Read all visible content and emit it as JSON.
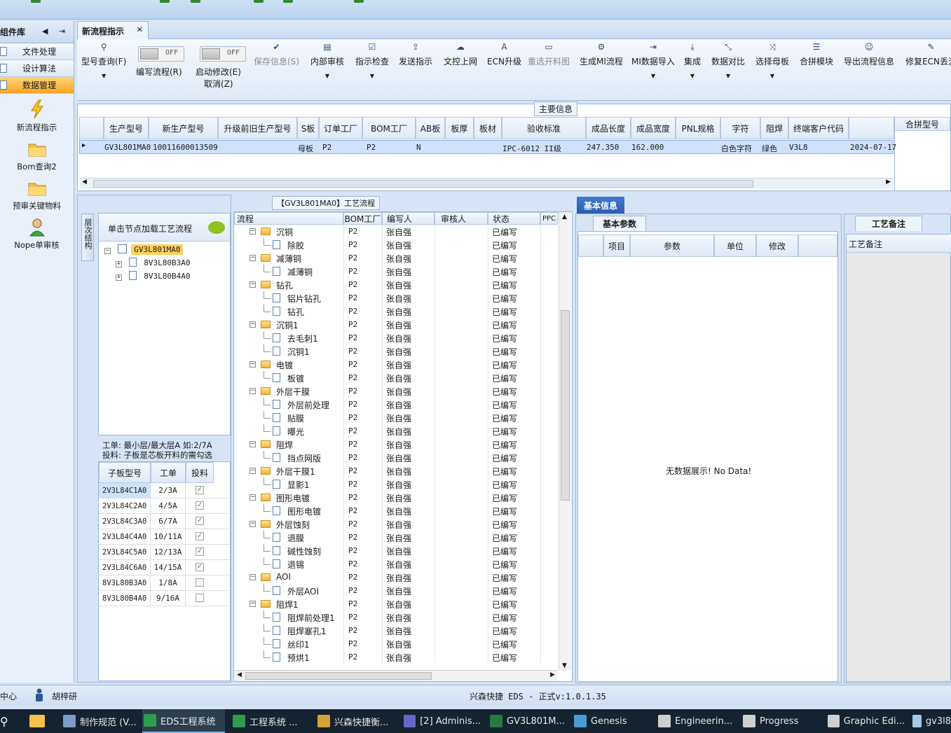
{
  "sidebar": {
    "title": "组件库",
    "categories": [
      {
        "label": "文件处理"
      },
      {
        "label": "设计算法"
      },
      {
        "label": "数据管理"
      }
    ],
    "items": [
      {
        "label": "新流程指示",
        "icon": "lightning-icon"
      },
      {
        "label": "Bom查询2",
        "icon": "folder-icon"
      },
      {
        "label": "预审关键物料",
        "icon": "folder-icon"
      },
      {
        "label": "Nope单审核",
        "icon": "user-icon"
      }
    ]
  },
  "tabs": [
    {
      "label": "新流程指示"
    }
  ],
  "toolbar": {
    "items": [
      {
        "label": "型号查询(F)"
      },
      {
        "label": "编写流程(R)",
        "toggle": "OFF"
      },
      {
        "label": "启动修改(E)",
        "toggle": "OFF",
        "sublabel": "取消(Z)"
      },
      {
        "label": "保存信息(S)",
        "disabled": true
      },
      {
        "label": "内部审核"
      },
      {
        "label": "指示检查"
      },
      {
        "label": "发送指示"
      },
      {
        "label": "文控上网"
      },
      {
        "label": "ECN升级"
      },
      {
        "label": "重选开料图",
        "disabled": true
      },
      {
        "label": "生成MI流程"
      },
      {
        "label": "MI数据导入"
      },
      {
        "label": "集成"
      },
      {
        "label": "数据对比"
      },
      {
        "label": "选择母板"
      },
      {
        "label": "合拼模块"
      },
      {
        "label": "导出流程信息"
      },
      {
        "label": "修复ECN丢流"
      }
    ]
  },
  "main_info": {
    "caption": "主要信息",
    "columns": [
      "生产型号",
      "新生产型号",
      "升级前旧生产型号",
      "S板",
      "订单工厂",
      "BOM工厂",
      "AB板",
      "板厚",
      "板材",
      "验收标准",
      "成品长度",
      "成品宽度",
      "PNL规格",
      "字符",
      "阻焊",
      "终端客户代码"
    ],
    "row": {
      "model": "GV3L801MA0",
      "new_model": "10011600013509",
      "s_board": "母板",
      "order_factory": "P2",
      "bom_factory": "P2",
      "ab_board": "N",
      "standard": "IPC-6012 II级",
      "length": "247.350",
      "width": "162.000",
      "char": "白色字符",
      "solder": "绿色",
      "customer": "V3L8",
      "date": "2024-07-17"
    },
    "merge_header": "合拼型号"
  },
  "structure_panel": {
    "vtab": "层次结构",
    "hint": "单击节点加载工艺流程",
    "tree": [
      {
        "label": "GV3L801MA0",
        "selected": true
      },
      {
        "label": "8V3L80B3A0"
      },
      {
        "label": "8V3L80B4A0"
      }
    ],
    "note_line1": "工单: 最小层/最大层A 如:2/7A",
    "note_line2": "投料: 子板是芯板开料的需勾选",
    "sub_columns": [
      "子板型号",
      "工单",
      "投料"
    ],
    "sub_rows": [
      {
        "model": "2V3L84C1A0",
        "order": "2/3A",
        "feed": "✓"
      },
      {
        "model": "2V3L84C2A0",
        "order": "4/5A",
        "feed": "✓"
      },
      {
        "model": "2V3L84C3A0",
        "order": "6/7A",
        "feed": "✓"
      },
      {
        "model": "2V3L84C4A0",
        "order": "10/11A",
        "feed": "✓"
      },
      {
        "model": "2V3L84C5A0",
        "order": "12/13A",
        "feed": "✓"
      },
      {
        "model": "2V3L84C6A0",
        "order": "14/15A",
        "feed": "✓"
      },
      {
        "model": "8V3L80B3A0",
        "order": "1/8A",
        "feed": ""
      },
      {
        "model": "8V3L80B4A0",
        "order": "9/16A",
        "feed": ""
      }
    ]
  },
  "process_panel": {
    "caption": "【GV3L801MA0】工艺流程",
    "columns": [
      "流程",
      "BOM工厂",
      "编写人",
      "审核人",
      "状态",
      "PPC"
    ],
    "rows": [
      {
        "name": "沉铜",
        "level": 0,
        "f": "P2",
        "w": "张自强",
        "s": "已编写"
      },
      {
        "name": "除胶",
        "level": 1,
        "f": "P2",
        "w": "张自强",
        "s": "已编写"
      },
      {
        "name": "减薄铜",
        "level": 0,
        "f": "P2",
        "w": "张自强",
        "s": "已编写"
      },
      {
        "name": "减薄铜",
        "level": 1,
        "f": "P2",
        "w": "张自强",
        "s": "已编写"
      },
      {
        "name": "钻孔",
        "level": 0,
        "f": "P2",
        "w": "张自强",
        "s": "已编写"
      },
      {
        "name": "铝片钻孔",
        "level": 1,
        "f": "P2",
        "w": "张自强",
        "s": "已编写"
      },
      {
        "name": "钻孔",
        "level": 1,
        "f": "P2",
        "w": "张自强",
        "s": "已编写"
      },
      {
        "name": "沉铜1",
        "level": 0,
        "f": "P2",
        "w": "张自强",
        "s": "已编写"
      },
      {
        "name": "去毛刺1",
        "level": 1,
        "f": "P2",
        "w": "张自强",
        "s": "已编写"
      },
      {
        "name": "沉铜1",
        "level": 1,
        "f": "P2",
        "w": "张自强",
        "s": "已编写"
      },
      {
        "name": "电镀",
        "level": 0,
        "f": "P2",
        "w": "张自强",
        "s": "已编写"
      },
      {
        "name": "板镀",
        "level": 1,
        "f": "P2",
        "w": "张自强",
        "s": "已编写"
      },
      {
        "name": "外层干膜",
        "level": 0,
        "f": "P2",
        "w": "张自强",
        "s": "已编写"
      },
      {
        "name": "外层前处理",
        "level": 1,
        "f": "P2",
        "w": "张自强",
        "s": "已编写"
      },
      {
        "name": "贴膜",
        "level": 1,
        "f": "P2",
        "w": "张自强",
        "s": "已编写"
      },
      {
        "name": "曝光",
        "level": 1,
        "f": "P2",
        "w": "张自强",
        "s": "已编写"
      },
      {
        "name": "阻焊",
        "level": 0,
        "f": "P2",
        "w": "张自强",
        "s": "已编写"
      },
      {
        "name": "挡点网版",
        "level": 1,
        "f": "P2",
        "w": "张自强",
        "s": "已编写"
      },
      {
        "name": "外层干膜1",
        "level": 0,
        "f": "P2",
        "w": "张自强",
        "s": "已编写"
      },
      {
        "name": "显影1",
        "level": 1,
        "f": "P2",
        "w": "张自强",
        "s": "已编写"
      },
      {
        "name": "图形电镀",
        "level": 0,
        "f": "P2",
        "w": "张自强",
        "s": "已编写"
      },
      {
        "name": "图形电镀",
        "level": 1,
        "f": "P2",
        "w": "张自强",
        "s": "已编写"
      },
      {
        "name": "外层蚀刻",
        "level": 0,
        "f": "P2",
        "w": "张自强",
        "s": "已编写"
      },
      {
        "name": "退膜",
        "level": 1,
        "f": "P2",
        "w": "张自强",
        "s": "已编写"
      },
      {
        "name": "碱性蚀刻",
        "level": 1,
        "f": "P2",
        "w": "张自强",
        "s": "已编写"
      },
      {
        "name": "退锡",
        "level": 1,
        "f": "P2",
        "w": "张自强",
        "s": "已编写"
      },
      {
        "name": "AOI",
        "level": 0,
        "f": "P2",
        "w": "张自强",
        "s": "已编写"
      },
      {
        "name": "外层AOI",
        "level": 1,
        "f": "P2",
        "w": "张自强",
        "s": "已编写"
      },
      {
        "name": "阻焊1",
        "level": 0,
        "f": "P2",
        "w": "张自强",
        "s": "已编写"
      },
      {
        "name": "阻焊前处理1",
        "level": 1,
        "f": "P2",
        "w": "张自强",
        "s": "已编写"
      },
      {
        "name": "阻焊塞孔1",
        "level": 1,
        "f": "P2",
        "w": "张自强",
        "s": "已编写"
      },
      {
        "name": "丝印1",
        "level": 1,
        "f": "P2",
        "w": "张自强",
        "s": "已编写"
      },
      {
        "name": "预烘1",
        "level": 1,
        "f": "P2",
        "w": "张自强",
        "s": "已编写"
      }
    ]
  },
  "basic_info": {
    "tab": "基本信息",
    "subtab": "基本参数",
    "columns": [
      "项目",
      "参数",
      "单位",
      "修改"
    ],
    "empty_text": "无数据展示! No Data!"
  },
  "remark": {
    "tab": "工艺备注",
    "header": "工艺备注"
  },
  "status": {
    "left": "中心",
    "user": "胡梓研",
    "center": "兴森快捷 EDS - 正式v:1.0.1.35"
  },
  "taskbar": [
    {
      "label": "制作规范 (V...",
      "color": "#7a9cc6"
    },
    {
      "label": "EDS工程系统",
      "color": "#2e9b4e",
      "active": true
    },
    {
      "label": "工程系统 ...",
      "color": "#2e9b4e"
    },
    {
      "label": "兴森快捷衡...",
      "color": "#d7a13a"
    },
    {
      "label": "[2] Adminis...",
      "color": "#6a63c9"
    },
    {
      "label": "GV3L801M...",
      "color": "#2a7a3f"
    },
    {
      "label": "Genesis",
      "color": "#4a9ad4"
    },
    {
      "label": "Engineerin...",
      "color": "#cfcfcf"
    },
    {
      "label": "Progress",
      "color": "#cfcfcf"
    },
    {
      "label": "Graphic Edi...",
      "color": "#cfcfcf"
    },
    {
      "label": "gv3l8",
      "color": "#a6c8e8"
    }
  ]
}
